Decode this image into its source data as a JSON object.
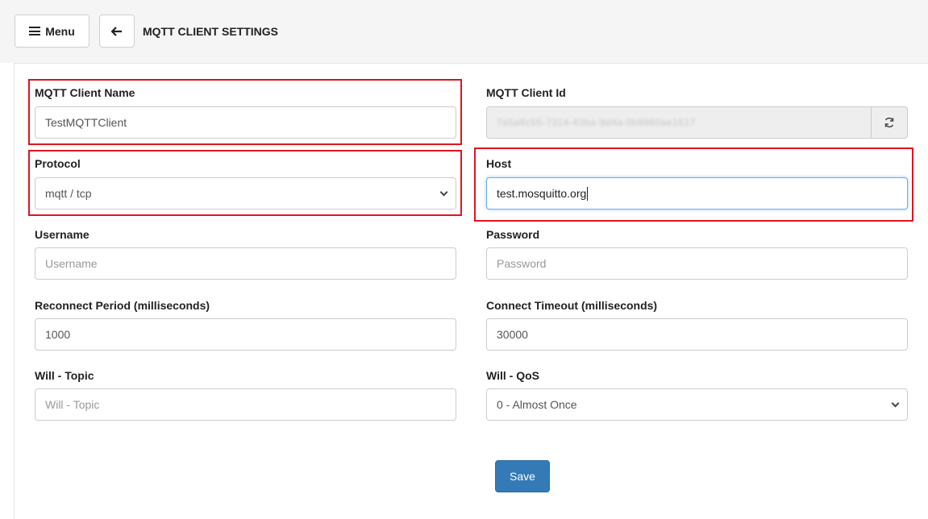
{
  "header": {
    "menu_label": "Menu",
    "menu_icon": "hamburger-icon",
    "back_icon": "arrow-left-icon",
    "title": "MQTT CLIENT SETTINGS"
  },
  "form": {
    "client_name": {
      "label": "MQTT Client Name",
      "value": "TestMQTTClient"
    },
    "client_id": {
      "label": "MQTT Client Id",
      "value": "7a5a6c55-7314-43ba-9d4a-0b9960ae1617",
      "refresh_icon": "refresh-icon"
    },
    "protocol": {
      "label": "Protocol",
      "value": "mqtt / tcp"
    },
    "host": {
      "label": "Host",
      "value": "test.mosquitto.org"
    },
    "username": {
      "label": "Username",
      "placeholder": "Username"
    },
    "password": {
      "label": "Password",
      "placeholder": "Password"
    },
    "reconnect_period": {
      "label": "Reconnect Period (milliseconds)",
      "value": "1000"
    },
    "connect_timeout": {
      "label": "Connect Timeout (milliseconds)",
      "value": "30000"
    },
    "will_topic": {
      "label": "Will - Topic",
      "placeholder": "Will - Topic"
    },
    "will_qos": {
      "label": "Will - QoS",
      "value": "0 - Almost Once"
    }
  },
  "save_label": "Save",
  "colors": {
    "highlight": "#e0141e",
    "primary": "#337ab7",
    "focus": "#66afe9"
  }
}
